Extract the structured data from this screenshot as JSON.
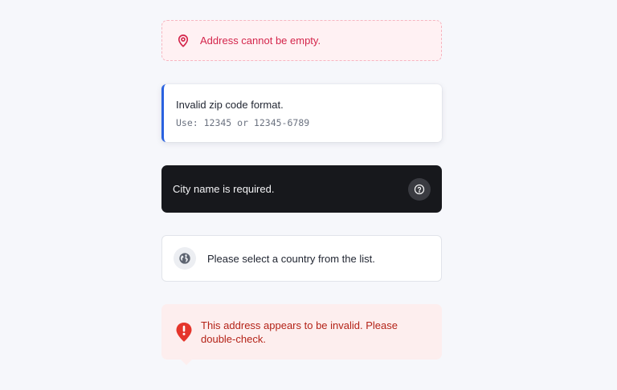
{
  "alerts": {
    "address_empty": {
      "message": "Address cannot be empty.",
      "icon": "map-pin-icon",
      "color": "#d4254b"
    },
    "zip_invalid": {
      "message": "Invalid zip code format.",
      "hint": "Use: 12345 or 12345-6789",
      "accent": "#2a62e0"
    },
    "city_required": {
      "message": "City name is required.",
      "icon": "help-circle-icon",
      "background": "#17181c"
    },
    "country_select": {
      "message": "Please select a country from the list.",
      "icon": "globe-icon"
    },
    "address_invalid": {
      "message": "This address appears to be invalid. Please double-check.",
      "icon": "exclamation-pin-icon",
      "color": "#b42318"
    }
  }
}
